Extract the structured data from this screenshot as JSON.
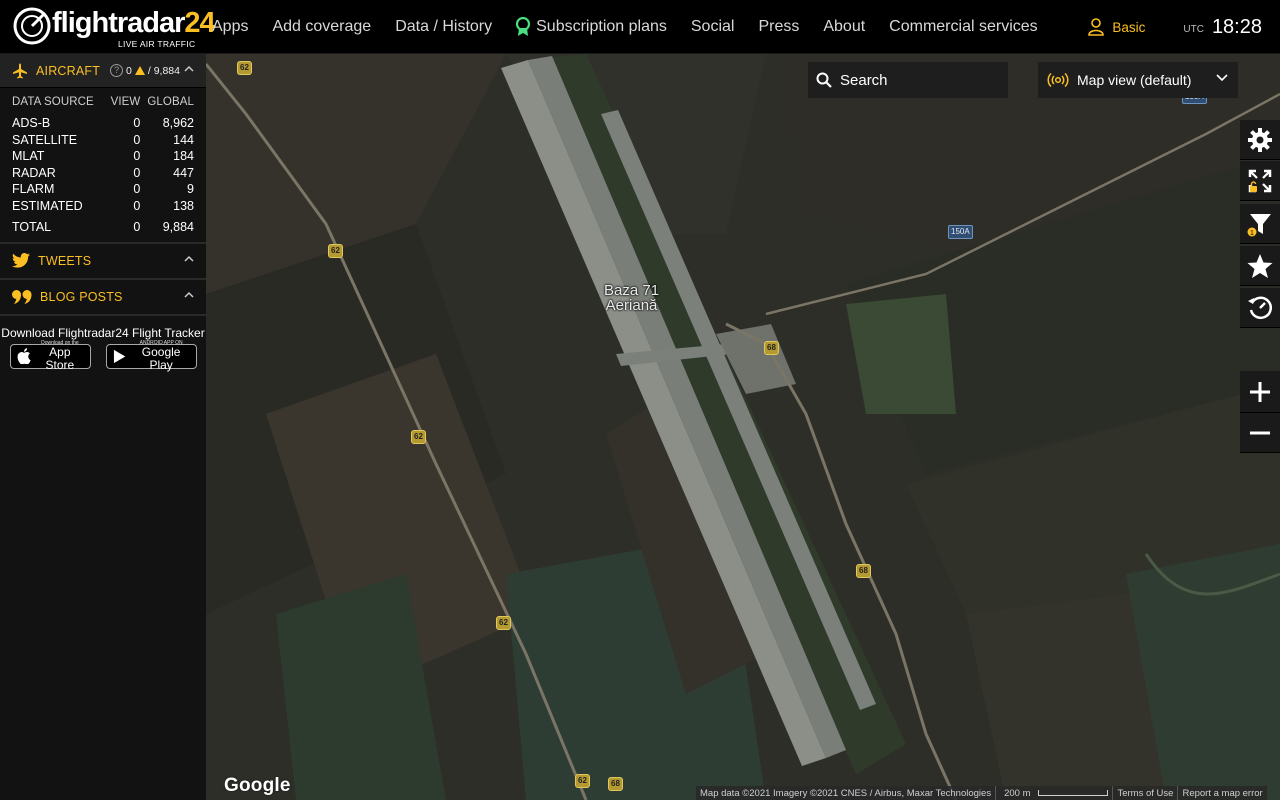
{
  "logo": {
    "word": "flightradar",
    "num": "24",
    "tagline": "LIVE AIR TRAFFIC"
  },
  "nav": {
    "items": [
      {
        "label": "Apps"
      },
      {
        "label": "Add coverage"
      },
      {
        "label": "Data / History"
      },
      {
        "label": "Subscription plans",
        "icon": "award-icon"
      },
      {
        "label": "Social"
      },
      {
        "label": "Press"
      },
      {
        "label": "About"
      },
      {
        "label": "Commercial services"
      }
    ]
  },
  "user": {
    "plan": "Basic",
    "tz": "UTC",
    "time": "18:28"
  },
  "sidebar": {
    "aircraft": {
      "title": "AIRCRAFT",
      "help": "?",
      "view_count": "0",
      "global_count": "/ 9,884"
    },
    "stats": {
      "headers": {
        "source": "DATA SOURCE",
        "view": "VIEW",
        "global": "GLOBAL"
      },
      "rows": [
        {
          "source": "ADS-B",
          "view": "0",
          "global": "8,962"
        },
        {
          "source": "SATELLITE",
          "view": "0",
          "global": "144"
        },
        {
          "source": "MLAT",
          "view": "0",
          "global": "184"
        },
        {
          "source": "RADAR",
          "view": "0",
          "global": "447"
        },
        {
          "source": "FLARM",
          "view": "0",
          "global": "9"
        },
        {
          "source": "ESTIMATED",
          "view": "0",
          "global": "138"
        }
      ],
      "total": {
        "source": "TOTAL",
        "view": "0",
        "global": "9,884"
      }
    },
    "tweets": {
      "title": "TWEETS"
    },
    "blog": {
      "title": "BLOG POSTS"
    },
    "download": {
      "title": "Download Flightradar24 Flight Tracker",
      "appstore_small": "Download on the",
      "appstore_big": "App Store",
      "play_small": "ANDROID APP ON",
      "play_big": "Google Play"
    }
  },
  "map": {
    "search_label": "Search",
    "view_label": "Map view (default)",
    "place_label_line1": "Baza 71",
    "place_label_line2": "Aeriană",
    "roads": [
      "62",
      "62",
      "62",
      "62",
      "62",
      "68",
      "68",
      "68",
      "150A",
      "150A"
    ],
    "google": "Google",
    "attribution": {
      "data": "Map data ©2021 Imagery ©2021 CNES / Airbus, Maxar Technologies",
      "scale": "200 m",
      "terms": "Terms of Use",
      "report": "Report a map error"
    }
  },
  "colors": {
    "accent": "#fbbf24",
    "topbar": "#000000",
    "sidebar": "#121212"
  }
}
